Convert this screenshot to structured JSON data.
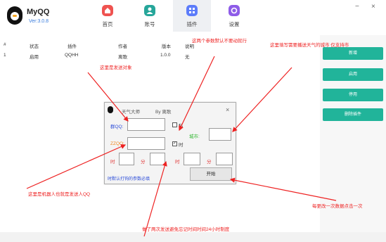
{
  "app": {
    "name": "MyQQ",
    "version": "Ver:3.0.8"
  },
  "nav": [
    {
      "label": "首页",
      "icon": "home-icon",
      "color": "#ef5350"
    },
    {
      "label": "账号",
      "icon": "account-icon",
      "color": "#26a69a"
    },
    {
      "label": "插件",
      "icon": "plugin-icon",
      "color": "#5c7cfa"
    },
    {
      "label": "设置",
      "icon": "settings-icon",
      "color": "#8e5ce8"
    }
  ],
  "window": {
    "minimize": "−",
    "close": "×"
  },
  "table": {
    "headers": [
      "#",
      "状态",
      "插件",
      "作者",
      "版本",
      "说明"
    ],
    "rows": [
      [
        "1",
        "启用",
        "QQHH",
        "离歌",
        "1.0.0",
        "无"
      ]
    ]
  },
  "side_buttons": [
    "新增",
    "启用",
    "停用",
    "删除插件"
  ],
  "dialog": {
    "title": "天气大师",
    "author": "By 离歌",
    "close": "×",
    "qq_label": "群QQ:",
    "qq_value": "",
    "zaozao_label": "ZZQQ:",
    "zaozao_value": "",
    "checkbox1_label": "私",
    "checkbox2_label": "时",
    "city_label": "城市:",
    "city_value": "",
    "hour1_label": "时",
    "minute_label": "分",
    "hour2_label": "时",
    "minute2_label": "分",
    "hint": "时默认打钩的参数必填",
    "start_button": "开始"
  },
  "annotations": [
    "这里是发送对象",
    "这两个参数默认不要动就行",
    "这里填写需要播送天气的城市 仅支持市",
    "这里是机器人也就是发送人QQ",
    "做了两次发送避免忘记时间时间24小时制度",
    "每更改一次数据点击一次"
  ],
  "colors": {
    "accent_green": "#21b49a",
    "annotation_red": "#ee2222",
    "version_blue": "#3b7ddd"
  }
}
